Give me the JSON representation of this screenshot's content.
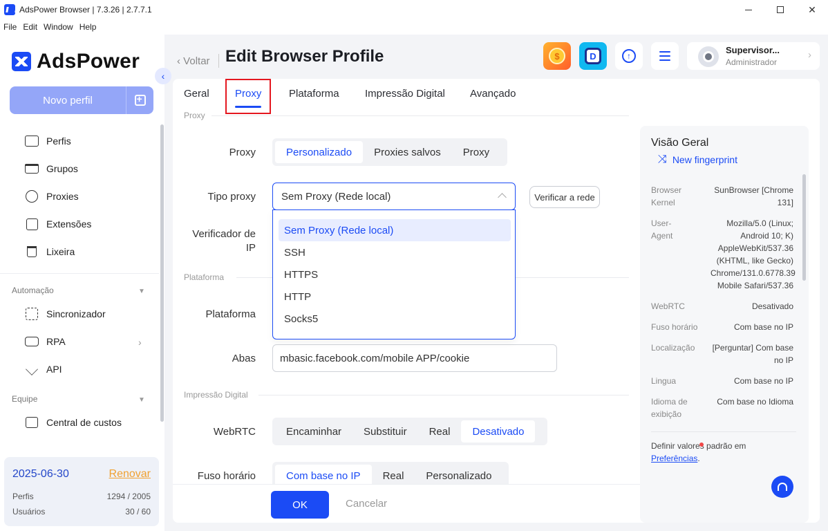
{
  "window": {
    "title": "AdsPower Browser | 7.3.26 | 2.7.7.1"
  },
  "menu": [
    "File",
    "Edit",
    "Window",
    "Help"
  ],
  "sidebar": {
    "logo": "AdsPower",
    "new_profile": "Novo perfil",
    "items": [
      {
        "label": "Perfis",
        "icon": "profile-icon"
      },
      {
        "label": "Grupos",
        "icon": "folder-icon"
      },
      {
        "label": "Proxies",
        "icon": "globe-icon"
      },
      {
        "label": "Extensões",
        "icon": "puzzle-icon"
      },
      {
        "label": "Lixeira",
        "icon": "trash-icon"
      }
    ],
    "automation_label": "Automação",
    "automation_items": [
      {
        "label": "Sincronizador",
        "icon": "sync-icon"
      },
      {
        "label": "RPA",
        "icon": "robot-icon"
      },
      {
        "label": "API",
        "icon": "plug-icon"
      }
    ],
    "team_label": "Equipe",
    "team_items": [
      {
        "label": "Central de custos",
        "icon": "billing-icon"
      }
    ],
    "license": {
      "date": "2025-06-30",
      "renew": "Renovar",
      "profiles_label": "Perfis",
      "profiles_value": "1294 / 2005",
      "users_label": "Usuários",
      "users_value": "30 / 60"
    }
  },
  "header": {
    "back": "Voltar",
    "title": "Edit Browser Profile",
    "user_name": "Supervisor...",
    "user_role": "Administrador"
  },
  "tabs": [
    "Geral",
    "Proxy",
    "Plataforma",
    "Impressão Digital",
    "Avançado"
  ],
  "active_tab": "Proxy",
  "form": {
    "section_proxy": "Proxy",
    "proxy_label": "Proxy",
    "proxy_options": [
      "Personalizado",
      "Proxies salvos",
      "Proxy"
    ],
    "proxy_selected": "Personalizado",
    "proxy_type_label": "Tipo proxy",
    "proxy_type_value": "Sem Proxy (Rede local)",
    "check_network": "Verificar a rede",
    "ip_checker_label_1": "Verificador de",
    "ip_checker_label_2": "IP",
    "dropdown_options": [
      "Sem Proxy (Rede local)",
      "SSH",
      "HTTPS",
      "HTTP",
      "Socks5"
    ],
    "section_platform": "Plataforma",
    "platform_label": "Plataforma",
    "tabs_label": "Abas",
    "tabs_value": "mbasic.facebook.com/mobile APP/cookie",
    "section_fingerprint": "Impressão Digital",
    "webrtc_label": "WebRTC",
    "webrtc_options": [
      "Encaminhar",
      "Substituir",
      "Real",
      "Desativado"
    ],
    "webrtc_selected": "Desativado",
    "timezone_label": "Fuso horário",
    "timezone_options": [
      "Com base no IP",
      "Real",
      "Personalizado"
    ],
    "timezone_selected": "Com base no IP"
  },
  "footer": {
    "ok": "OK",
    "cancel": "Cancelar"
  },
  "overview": {
    "title": "Visão Geral",
    "new_fingerprint": "New fingerprint",
    "rows": [
      {
        "k": "Browser Kernel",
        "v": "SunBrowser [Chrome 131]"
      },
      {
        "k": "User-Agent",
        "v": "Mozilla/5.0 (Linux; Android 10; K) AppleWebKit/537.36 (KHTML, like Gecko) Chrome/131.0.6778.39 Mobile Safari/537.36"
      },
      {
        "k": "WebRTC",
        "v": "Desativado"
      },
      {
        "k": "Fuso horário",
        "v": "Com base no IP"
      },
      {
        "k": "Localização",
        "v": "[Perguntar] Com base no IP"
      },
      {
        "k": "Lingua",
        "v": "Com base no IP"
      },
      {
        "k": "Idioma de exibição",
        "v": "Com base no Idioma"
      }
    ],
    "defaults_text": "Definir valores padrão em",
    "defaults_link": "Preferências",
    "defaults_end": "."
  },
  "colors": {
    "accent": "#1b4bf5",
    "highlight": "#e4171f",
    "renew": "#f0a030"
  }
}
